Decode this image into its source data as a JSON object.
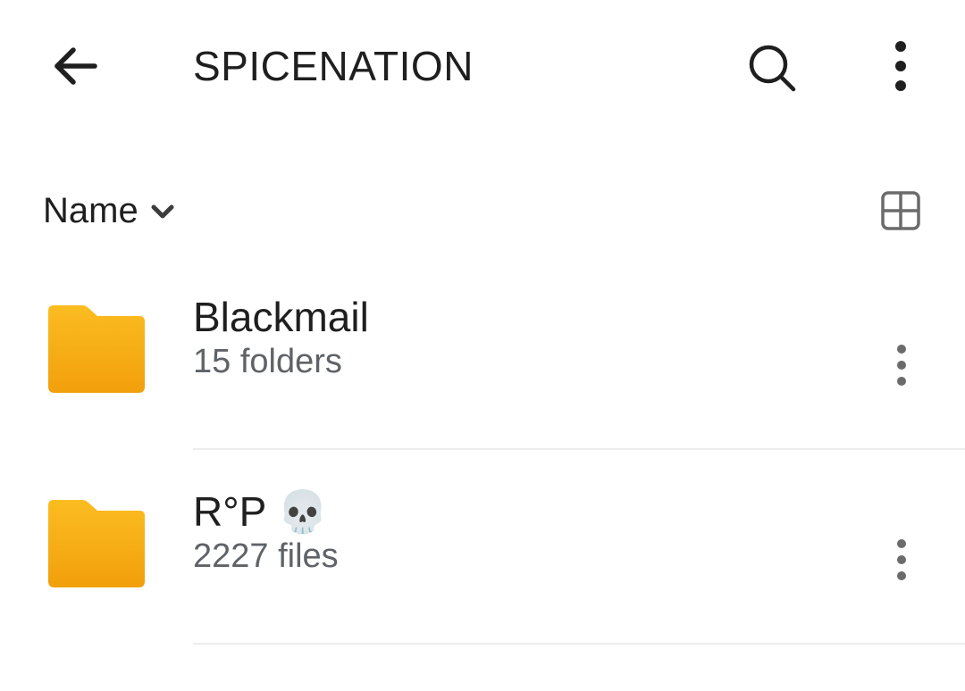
{
  "appbar": {
    "title": "SPICENATION",
    "back_icon": "arrow-back-icon",
    "search_icon": "search-icon",
    "more_icon": "more-vert-icon"
  },
  "sort": {
    "label": "Name",
    "chevron_icon": "chevron-down-icon",
    "view_icon": "grid-view-icon"
  },
  "items": [
    {
      "name": "Blackmail",
      "meta": "15 folders",
      "icon": "folder-icon"
    },
    {
      "name": "R°P 💀",
      "meta": "2227 files",
      "icon": "folder-icon"
    }
  ],
  "colors": {
    "folder_top": "#fbbd21",
    "folder_bottom": "#f29f0b",
    "text_primary": "#1f1f1f",
    "text_secondary": "#5f6368",
    "icon_dark": "#1f1f1f",
    "icon_grey": "#6b6b6b"
  }
}
